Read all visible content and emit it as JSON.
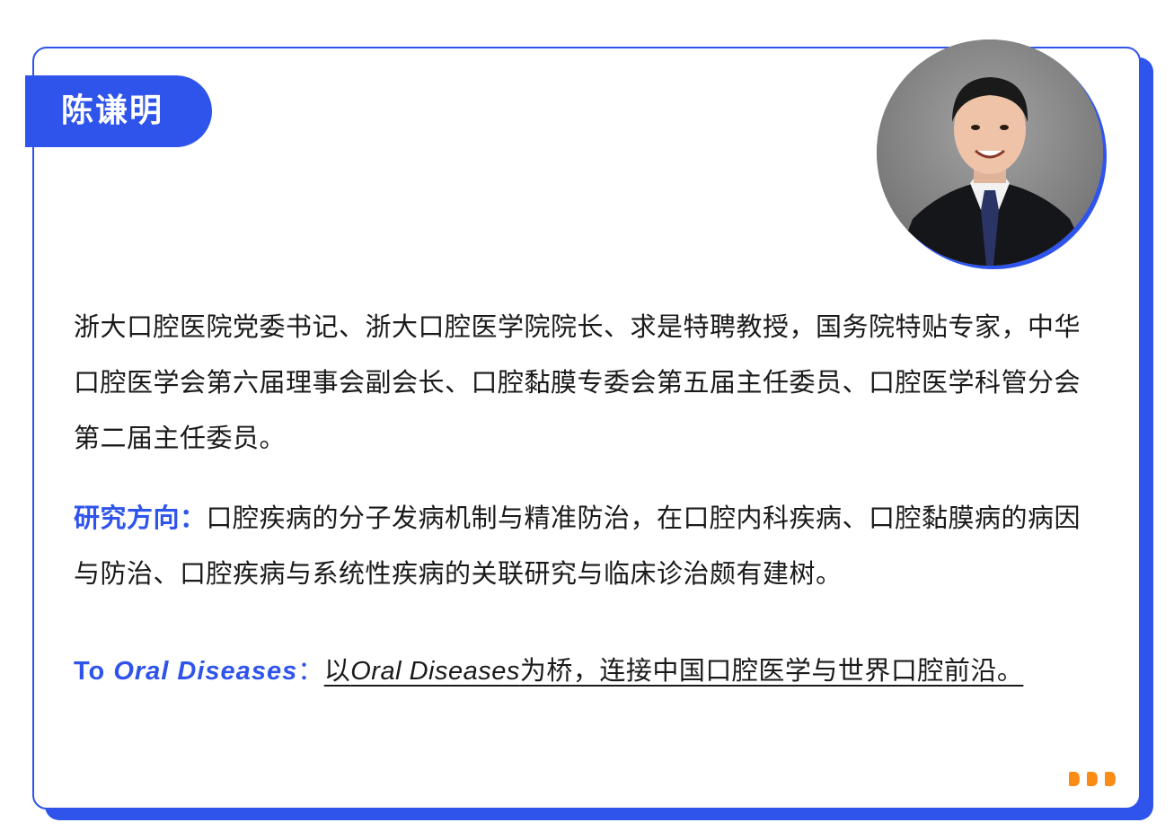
{
  "person": {
    "name": "陈谦明"
  },
  "bio": "浙大口腔医院党委书记、浙大口腔医学院院长、求是特聘教授，国务院特贴专家，中华口腔医学会第六届理事会副会长、口腔黏膜专委会第五届主任委员、口腔医学科管分会第二届主任委员。",
  "research": {
    "label": "研究方向：",
    "text": "口腔疾病的分子发病机制与精准防治，在口腔内科疾病、口腔黏膜病的病因与防治、口腔疾病与系统性疾病的关联研究与临床诊治颇有建树。"
  },
  "oral": {
    "label_prefix": "To ",
    "label_italic": "Oral Diseases",
    "colon": "：",
    "text_before": "以",
    "text_italic": "Oral Diseases",
    "text_after": "为桥，连接中国口腔医学与世界口腔前沿。"
  },
  "colors": {
    "accent": "#2f54eb",
    "dots": "#fa8c16"
  },
  "icons": {
    "decor": "triple-dot-icon"
  }
}
